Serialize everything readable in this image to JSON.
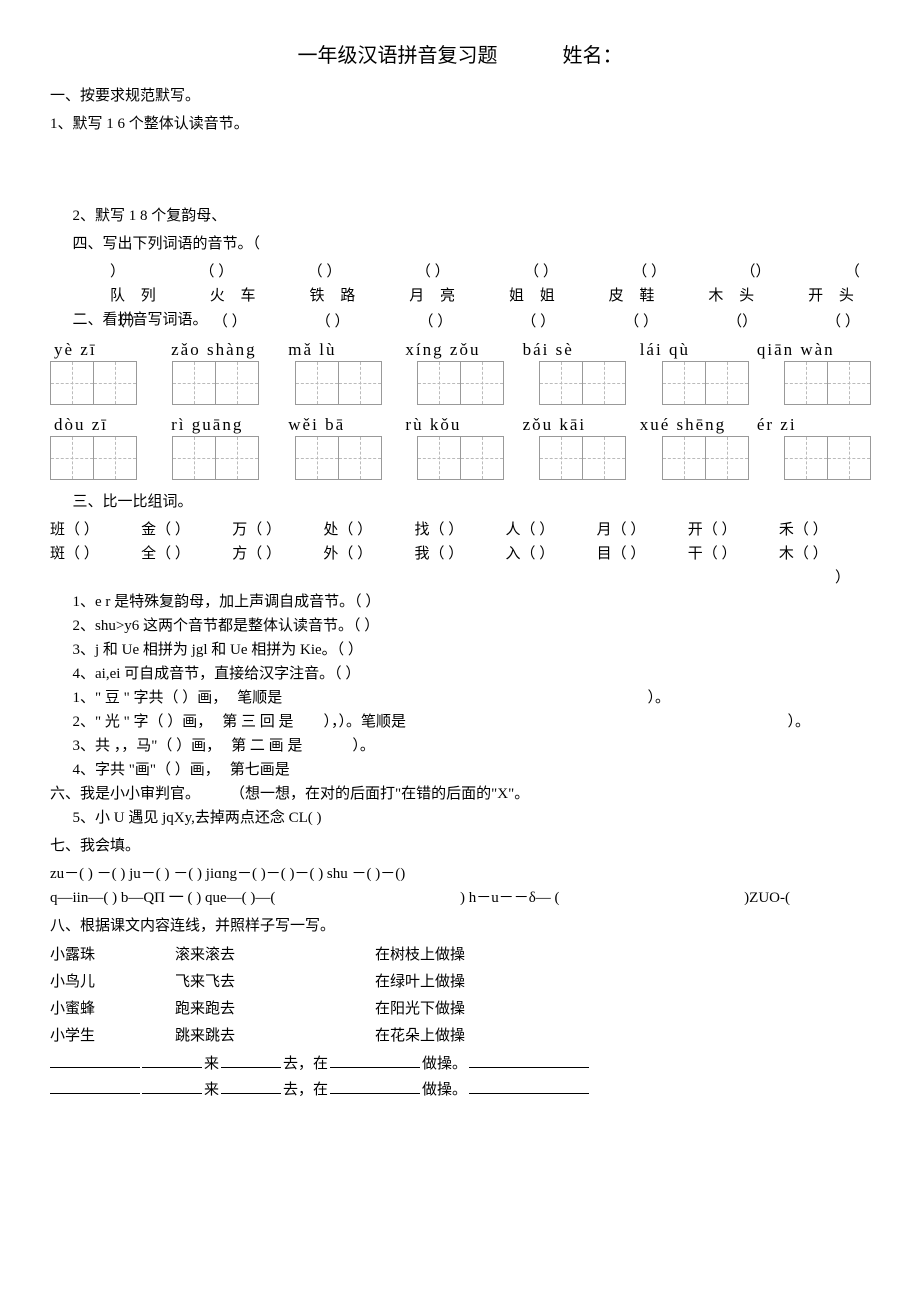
{
  "title": "一年级汉语拼音复习题",
  "name_label": "姓名：",
  "sections": {
    "s1": "一、按要求规范默写。",
    "s1_1": "1、默写 1 6 个整体认读音节。",
    "s2_1": "2、默写 1 8 个复韵母、",
    "s4": "四、写出下列词语的音节。（",
    "s2": "二、看拼音写词语。",
    "s3": "三、比一比组词。",
    "s6": "六、我是小小审判官。",
    "s6_hint": "（想一想，在对的后面打\"在错的后面的\"X\"。",
    "s7": "七、我会填。",
    "s8": "八、根据课文内容连线，并照样子写一写。"
  },
  "q4": {
    "parens": [
      "）",
      "（      ）",
      "（      ）",
      "（      ）",
      "（      ）",
      "（      ）",
      "（）",
      "（"
    ],
    "words": [
      "队 列",
      "火 车",
      "铁 路",
      "月 亮",
      "姐 姐",
      "皮 鞋",
      "木 头",
      "开 头"
    ],
    "parens2": [
      "（      ）",
      "（      ）",
      "（      ）",
      "（      ）",
      "（      ）",
      "（      ）",
      "（）",
      "（      ）"
    ]
  },
  "pinyin": {
    "row1": [
      "yè  zī",
      "zǎo shàng",
      "mǎ  lù",
      "xíng zǒu",
      "bái  sè",
      "lái  qù",
      "qiān wàn"
    ],
    "row2": [
      "dòu  zī",
      "rì guāng",
      "wěi  bā",
      "rù  kǒu",
      "zǒu  kāi",
      "xué shēng",
      "ér  zi"
    ]
  },
  "q3": {
    "row1": [
      "班（    ）",
      "金（    ）",
      "万（    ）",
      "处（    ）",
      "找（    ）",
      "人（    ）",
      "月（    ）",
      "开（    ）",
      "禾（    ）"
    ],
    "row2": [
      "斑（    ）",
      "全（    ）",
      "方（    ）",
      "外（    ）",
      "我（    ）",
      "入（    ）",
      "目（    ）",
      "干（    ）",
      "木（    ）"
    ]
  },
  "close_paren": "）",
  "judge": {
    "j1": "1、e r 是特殊复韵母，加上声调自成音节。（            ）",
    "j2": "2、shu>y6 这两个音节都是整体认读音节。（            ）",
    "j3": "3、j 和 Ue 相拼为 jgl 和 Ue 相拼为 Kie。（          ）",
    "j4": "4、ai,ei 可自成音节，直接给汉字注音。（          ）",
    "j5": "5、小 U 遇见 jqXy,去掉两点还念 CL(                  )"
  },
  "strokes": {
    "l1_a": "1、\" 豆 \" 字共（     ）画，",
    "l1_b": "笔顺是",
    "l1_c": "）。",
    "l2_a": "2、\" 光 \" 字（     ）画，",
    "l2_b": "第 三 回 是",
    "l2_c": "），）。笔顺是",
    "l2_d": "）。",
    "l3_a": "3、共 ，，马\"（     ）画，",
    "l3_b": "第 二 画 是",
    "l3_c": "）。",
    "l4_a": "4、字共 \"画\"（     ）画，",
    "l4_b": "第七画是"
  },
  "fill": {
    "row1": "zu－(    ) －(   ) ju－(   ) －(   ) jiɑng－(    )－(    )－(     )  shu －(    )－()",
    "row2_a": "q—iin—( ) b—QΠ 一  (   )  que—( )—(",
    "row2_b": ") h－u－－δ—  (",
    "row2_c": ")ZUO-("
  },
  "match": {
    "col1": [
      "小露珠",
      "小鸟儿",
      "小蜜蜂",
      "小学生"
    ],
    "col2": [
      "滚来滚去",
      "飞来飞去",
      "跑来跑去",
      "跳来跳去"
    ],
    "col3": [
      "在树枝上做操",
      "在绿叶上做操",
      "在阳光下做操",
      "在花朵上做操"
    ]
  },
  "pattern": {
    "lai": "来",
    "qu": "去，在",
    "zuocao": "做操。"
  }
}
